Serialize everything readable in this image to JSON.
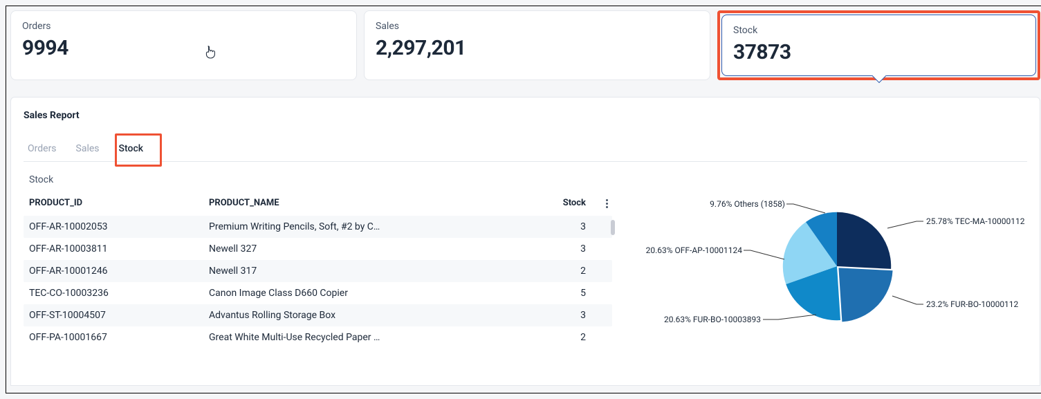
{
  "cards": {
    "orders": {
      "label": "Orders",
      "value": "9994"
    },
    "sales": {
      "label": "Sales",
      "value": "2,297,201"
    },
    "stock": {
      "label": "Stock",
      "value": "37873"
    }
  },
  "report": {
    "title": "Sales Report",
    "tabs": [
      "Orders",
      "Sales",
      "Stock"
    ],
    "active_tab": "Stock",
    "section_label": "Stock",
    "table": {
      "columns": [
        "PRODUCT_ID",
        "PRODUCT_NAME",
        "Stock"
      ],
      "rows": [
        {
          "id": "OFF-AR-10002053",
          "name": "Premium Writing Pencils, Soft, #2 by C…",
          "stock": "3"
        },
        {
          "id": "OFF-AR-10003811",
          "name": "Newell 327",
          "stock": "3"
        },
        {
          "id": "OFF-AR-10001246",
          "name": "Newell 317",
          "stock": "2"
        },
        {
          "id": "TEC-CO-10003236",
          "name": "Canon Image Class D660 Copier",
          "stock": "5"
        },
        {
          "id": "OFF-ST-10004507",
          "name": "Advantus Rolling Storage Box",
          "stock": "3"
        },
        {
          "id": "OFF-PA-10001667",
          "name": "Great White Multi-Use Recycled Paper …",
          "stock": "2"
        }
      ]
    }
  },
  "chart_data": {
    "type": "pie",
    "title": "",
    "slices": [
      {
        "label": "25.78% TEC-MA-10000112",
        "pct": 25.78,
        "color": "#0d2d5c"
      },
      {
        "label": "23.2% FUR-BO-10000112",
        "pct": 23.2,
        "color": "#1f6fb0"
      },
      {
        "label": "20.63% FUR-BO-10003893",
        "pct": 20.63,
        "color": "#1089c9"
      },
      {
        "label": "20.63% OFF-AP-10001124",
        "pct": 20.63,
        "color": "#8fd6f4"
      },
      {
        "label": "9.76% Others (1858)",
        "pct": 9.76,
        "color": "#1580c5"
      }
    ]
  }
}
